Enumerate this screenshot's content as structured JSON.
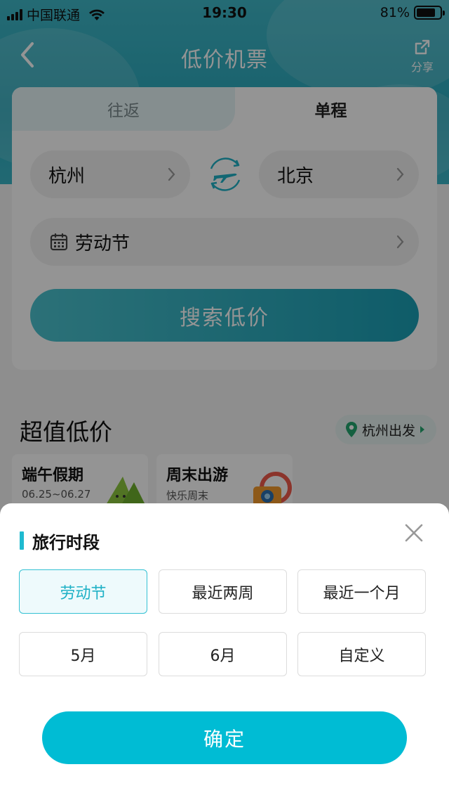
{
  "status": {
    "carrier": "中国联通",
    "time": "19:30",
    "battery": "81%"
  },
  "nav": {
    "title": "低价机票",
    "share_label": "分享"
  },
  "tabs": {
    "round_trip": "往返",
    "one_way": "单程"
  },
  "route": {
    "from": "杭州",
    "to": "北京"
  },
  "date": {
    "value": "劳动节"
  },
  "search": {
    "button": "搜索低价"
  },
  "deals": {
    "title": "超值低价",
    "depart_label": "杭州出发",
    "cards": [
      {
        "title": "端午假期",
        "subtitle": "06.25~06.27"
      },
      {
        "title": "周末出游",
        "subtitle": "快乐周末"
      }
    ]
  },
  "sheet": {
    "title": "旅行时段",
    "options": [
      "劳动节",
      "最近两周",
      "最近一个月",
      "5月",
      "6月",
      "自定义"
    ],
    "selected": "劳动节",
    "confirm": "确定"
  },
  "colors": {
    "accent": "#00bcd4",
    "brand_teal": "#2ba9bd"
  }
}
